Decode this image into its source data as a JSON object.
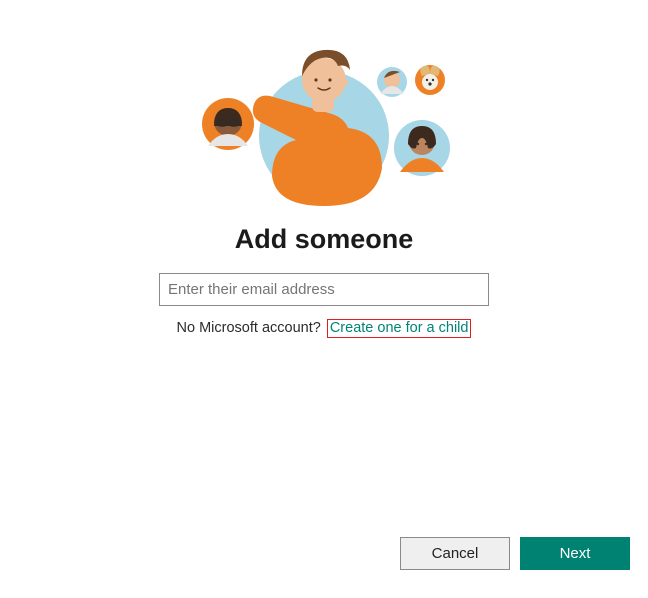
{
  "title": "Add someone",
  "email": {
    "placeholder": "Enter their email address",
    "value": ""
  },
  "sub": {
    "lead": "No Microsoft account?",
    "link": "Create one for a child"
  },
  "buttons": {
    "cancel": "Cancel",
    "next": "Next"
  },
  "colors": {
    "accent": "#008272",
    "link": "#008575",
    "highlight_box": "#e02020"
  }
}
